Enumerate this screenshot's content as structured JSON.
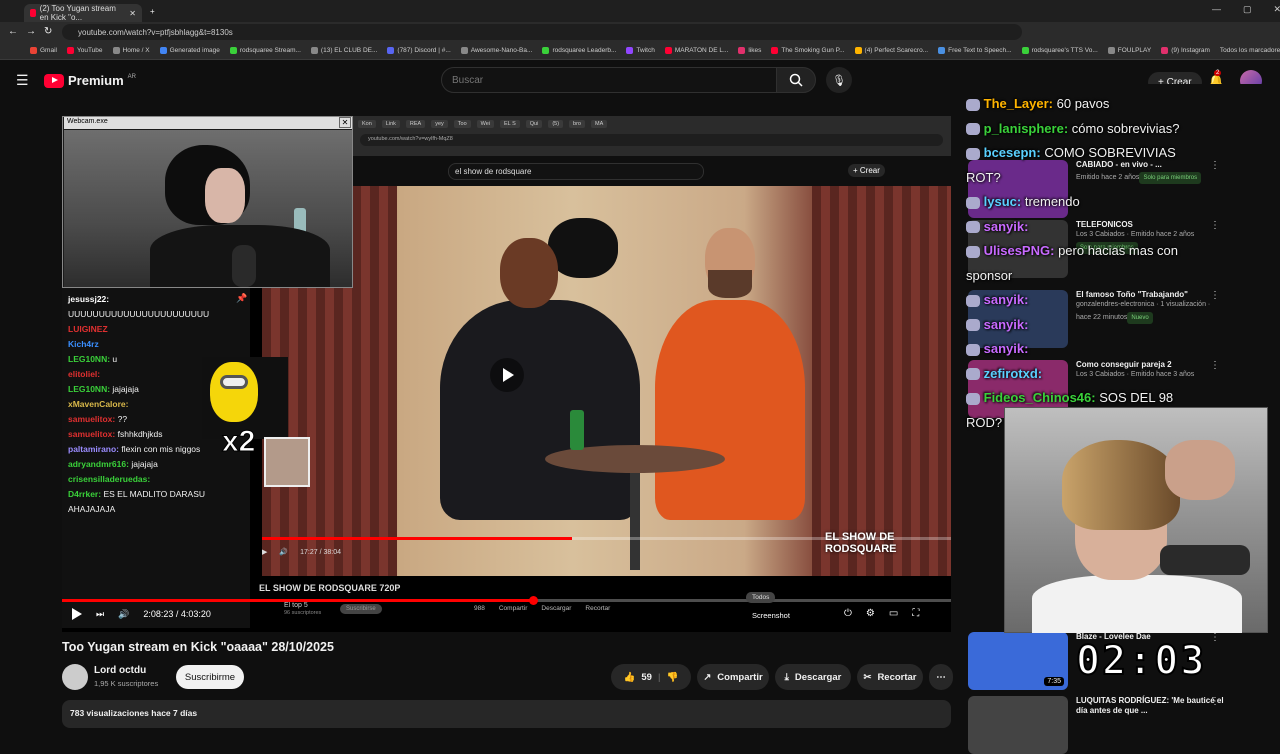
{
  "browser": {
    "tab_title": "(2) Too Yugan stream en Kick \"o...",
    "url": "youtube.com/watch?v=ptfjsbhlagg&t=8130s",
    "bookmarks": [
      "Gmail",
      "YouTube",
      "Home / X",
      "Generated image",
      "rodsquaree Stream...",
      "(13) EL CLUB DE...",
      "(787) Discord | #...",
      "Awesome-Nano-Ba...",
      "rodsquaree Leaderb...",
      "Twitch",
      "MARATON DE L...",
      "likes",
      "The Smoking Gun P...",
      "(4) Perfect Scarecro...",
      "Free Text to Speech...",
      "rodsquaree's TTS Vo...",
      "FOULPLAY",
      "(9) Instagram"
    ],
    "all_bookmarks": "Todos los marcadores"
  },
  "header": {
    "logo": "Premium",
    "region": "AR",
    "search_placeholder": "Buscar",
    "create": "Crear",
    "notifications": "2"
  },
  "player": {
    "webcam_title": "Webcam.exe",
    "inner_search": "el show de rodsquare",
    "inner_create": "Crear",
    "inner_time": "17:27 / 38:04",
    "overlay_title": "EL SHOW DE RODSQUARE",
    "inner_video_title": "EL SHOW DE RODSQUARE 720P",
    "inner_channel": "El top 5",
    "inner_subs": "96 suscriptores",
    "inner_subscribe": "Suscribirse",
    "inner_actions": [
      "988",
      "Compartir",
      "Descargar",
      "Recortar"
    ],
    "time": "2:08:23 / 4:03:20",
    "todos": "Todos",
    "screenshot": "Screenshot",
    "progress": 0.53,
    "inner_progress": 0.45
  },
  "chat_left": [
    {
      "user": "jesussj22:",
      "text": "",
      "color": "#ffffff"
    },
    {
      "user": "",
      "text": "UUUUUUUUUUUUUUUUUUUUUUU",
      "color": "#ffffff"
    },
    {
      "user": "LUIGINEZ",
      "text": "",
      "color": "#e03030"
    },
    {
      "user": "Kich4rz",
      "text": "",
      "color": "#3a8fff"
    },
    {
      "user": "LEG10NN:",
      "text": "u",
      "color": "#3ad13a"
    },
    {
      "user": "elitoliel:",
      "text": "",
      "color": "#e03030"
    },
    {
      "user": "LEG10NN:",
      "text": "jajajaja",
      "color": "#3ad13a"
    },
    {
      "user": "xMavenCalore:",
      "text": "",
      "color": "#d9b84a"
    },
    {
      "user": "samuelitox:",
      "text": "??",
      "color": "#e03030"
    },
    {
      "user": "samuelitox:",
      "text": "fshhkdhjkds",
      "color": "#e03030"
    },
    {
      "user": "paltamirano:",
      "text": "flexin con mis niggos",
      "color": "#9b8cff"
    },
    {
      "user": "adryandmr616:",
      "text": "jajajaja",
      "color": "#3ad13a"
    },
    {
      "user": "crisensilladeruedas:",
      "text": "",
      "color": "#3ad13a"
    },
    {
      "user": "D4rrker:",
      "text": "ES EL MADLITO DARASU AHAJAJAJA",
      "color": "#3ad13a"
    }
  ],
  "chat_right": [
    {
      "user": "The_Layer:",
      "text": "60 pavos",
      "color": "#ffb400"
    },
    {
      "user": "p_lanisphere:",
      "text": "cómo sobrevivias?",
      "color": "#3ad13a"
    },
    {
      "user": "bcesepn:",
      "text": "COMO SOBREVIVIAS ROT?",
      "color": "#5ad1ff"
    },
    {
      "user": "lysuc:",
      "text": "tremendo",
      "color": "#5ad1ff"
    },
    {
      "user": "sanyik:",
      "text": "",
      "color": "#c86aff"
    },
    {
      "user": "UlisesPNG:",
      "text": "pero hacias mas con sponsor",
      "color": "#c86aff"
    },
    {
      "user": "sanyik:",
      "text": "",
      "color": "#c86aff"
    },
    {
      "user": "sanyik:",
      "text": "",
      "color": "#c86aff"
    },
    {
      "user": "sanyik:",
      "text": "",
      "color": "#c86aff"
    },
    {
      "user": "zefirotxd:",
      "text": "",
      "color": "#5ad1ff"
    },
    {
      "user": "Fideos_Chinos46:",
      "text": "SOS DEL 98 ROD?",
      "color": "#3ad13a"
    }
  ],
  "video": {
    "title": "Too Yugan stream en Kick \"oaaaa\" 28/10/2025",
    "channel": "Lord octdu",
    "subs": "1,95 K suscriptores",
    "subscribe": "Suscribirme",
    "likes": "59",
    "share": "Compartir",
    "download": "Descargar",
    "clip": "Recortar",
    "views": "783 visualizaciones  hace 7 días"
  },
  "recommended": [
    {
      "title": "CABIADO - en vivo - ...",
      "meta": "Emitido hace 2 años",
      "badge": "Solo para miembros"
    },
    {
      "title": "TELEFONICOS",
      "meta": "Los 3 Cabiados · Emitido hace 2 años",
      "badge": "Solo para miembros"
    },
    {
      "title": "El famoso Toño \"Trabajando\"",
      "meta": "gonzalendres-electronica · 1 visualización · hace 22 minutos",
      "badge": "Nuevo"
    },
    {
      "title": "Como conseguir pareja 2",
      "meta": "Los 3 Cabiados · Emitido hace 3 años",
      "badge": ""
    },
    {
      "title": "Blaze - Lovelee Dae",
      "meta": "",
      "badge": "",
      "duration": "7:35"
    },
    {
      "title": "LUQUITAS RODRÍGUEZ: 'Me bauticé el día antes de que ...",
      "meta": "",
      "badge": ""
    }
  ],
  "clock": "02:03"
}
